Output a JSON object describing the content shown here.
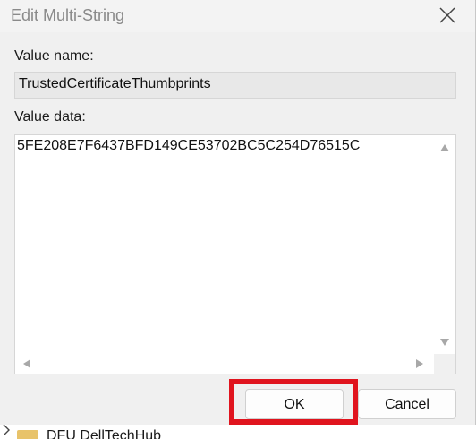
{
  "dialog": {
    "title": "Edit Multi-String",
    "value_name_label": "Value name:",
    "value_name": "TrustedCertificateThumbprints",
    "value_data_label": "Value data:",
    "value_data": "5FE208E7F6437BFD149CE53702BC5C254D76515C",
    "ok_label": "OK",
    "cancel_label": "Cancel"
  },
  "background": {
    "tree_item_label": "DFU DellTechHub"
  },
  "annotation": {
    "highlight_color": "#e0141e"
  }
}
